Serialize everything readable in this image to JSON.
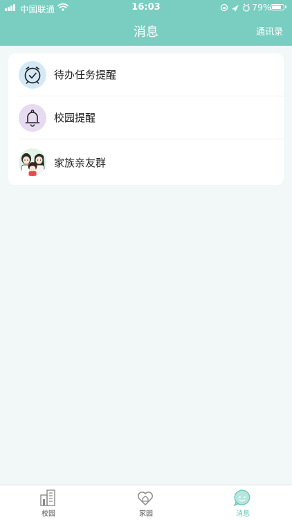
{
  "status_bar": {
    "carrier": "中国联通",
    "time": "16:03",
    "battery": "79%",
    "battery_level": 0.79
  },
  "nav": {
    "title": "消息",
    "right_action": "通讯录"
  },
  "messages": [
    {
      "label": "待办任务提醒",
      "icon": "alarm-clock-icon"
    },
    {
      "label": "校园提醒",
      "icon": "bell-icon"
    },
    {
      "label": "家族亲友群",
      "icon": "family-avatar"
    }
  ],
  "tabs": [
    {
      "label": "校园",
      "icon": "building-icon",
      "active": false
    },
    {
      "label": "家园",
      "icon": "heart-home-icon",
      "active": false
    },
    {
      "label": "消息",
      "icon": "chat-face-icon",
      "active": true
    }
  ],
  "colors": {
    "header": "#79cec1",
    "page_background": "#f1f8f7",
    "active_tab": "#69c7b8",
    "inactive_tab": "#8a8a8a",
    "clock_icon_bg": "#d4e9f5",
    "bell_icon_bg": "#e6dbf0"
  }
}
